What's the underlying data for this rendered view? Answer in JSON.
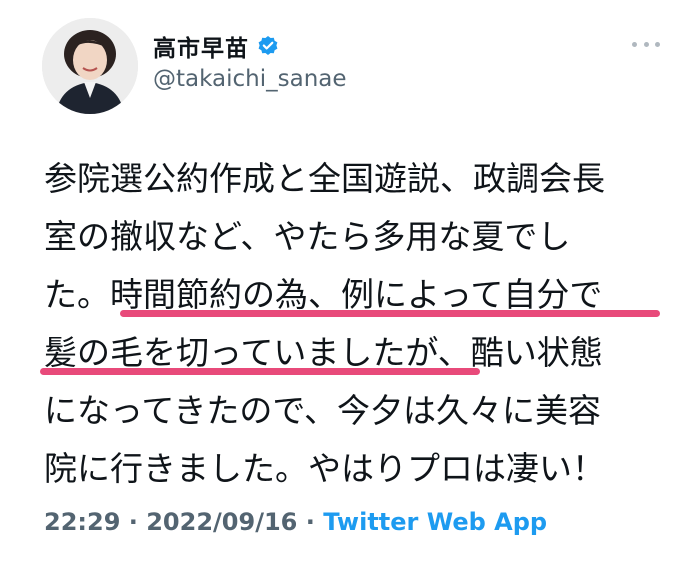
{
  "user": {
    "display_name": "高市早苗",
    "handle": "@takaichi_sanae",
    "verified_icon": "verified-badge-icon"
  },
  "tweet": {
    "lines": [
      "参院選公約作成と全国遊説、政調会長",
      "室の撤収など、やたら多用な夏でし",
      "た。時間節約の為、例によって自分で",
      "髪の毛を切っていましたが、酷い状態",
      "になってきたので、今夕は久々に美容",
      "院に行きました。やはりプロは凄い！"
    ],
    "time": "22:29",
    "separator": " · ",
    "date": "2022/09/16",
    "app": "Twitter Web App"
  },
  "colors": {
    "accent": "#1d9bf0",
    "underline": "#e84a7a",
    "text": "#0f1419",
    "muted": "#536471"
  }
}
